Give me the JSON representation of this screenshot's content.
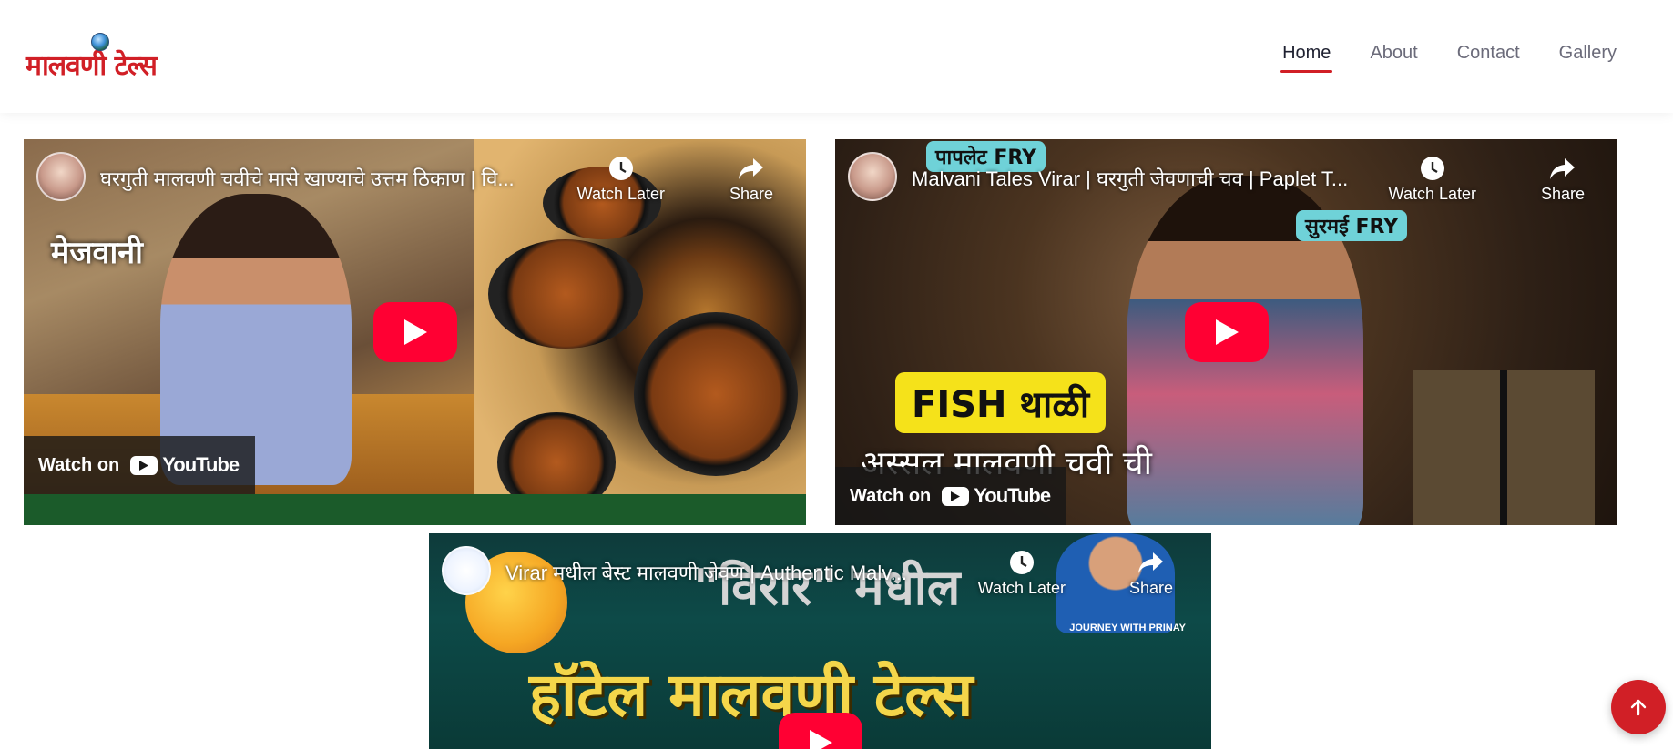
{
  "header": {
    "logo_text": "मालवणी टेल्स",
    "nav": [
      {
        "label": "Home",
        "active": true
      },
      {
        "label": "About",
        "active": false
      },
      {
        "label": "Contact",
        "active": false
      },
      {
        "label": "Gallery",
        "active": false
      }
    ]
  },
  "videos": [
    {
      "title": "घरगुती मालवणी चवीचे मासे खाण्याचे उत्तम ठिकाण | वि...",
      "watch_later": "Watch Later",
      "share": "Share",
      "watch_on": "Watch on",
      "youtube": "YouTube",
      "thumb_text_top": "मेजवानी"
    },
    {
      "title": "Malvani Tales Virar | घरगुती जेवणाची चव | Paplet T...",
      "watch_later": "Watch Later",
      "share": "Share",
      "watch_on": "Watch on",
      "youtube": "YouTube",
      "tag_paplet": "पापलेट FRY",
      "tag_surmai": "सुरमई FRY",
      "tag_fish": "FISH थाळी",
      "thumb_script": "अस्सल मालवणी चवी ची"
    },
    {
      "title": "Virar मधील बेस्ट मालवणी जेवण | Authentic Malv...",
      "watch_later": "Watch Later",
      "share": "Share",
      "thumb_virar": "\"विरार\" मधील",
      "thumb_title": "हॉटेल मालवणी टेल्स",
      "brand_note": "JOURNEY WITH PRINAY"
    }
  ],
  "colors": {
    "brand_red": "#d11f26",
    "youtube_red": "#ff0033"
  },
  "icons": {
    "back_to_top": "arrow-up-icon",
    "watch_later": "clock-icon",
    "share": "share-arrow-icon",
    "play": "play-icon"
  }
}
